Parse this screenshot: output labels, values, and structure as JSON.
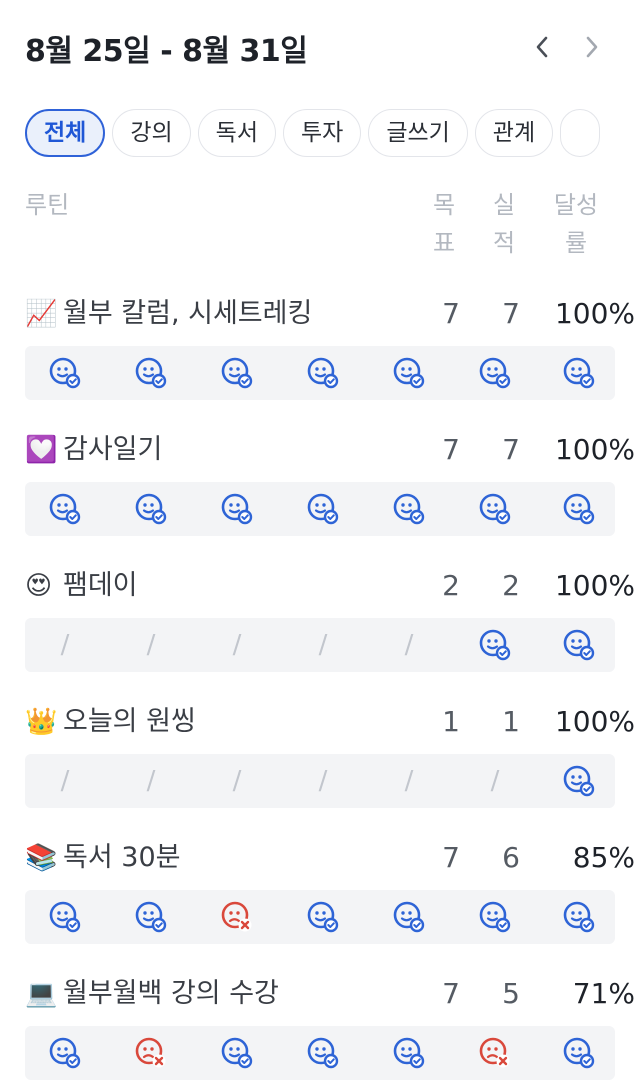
{
  "header": {
    "title": "8월 25일 - 8월 31일",
    "prev_icon": "chevron-left-icon",
    "next_icon": "chevron-right-icon"
  },
  "tabs": [
    {
      "label": "전체",
      "active": true
    },
    {
      "label": "강의",
      "active": false
    },
    {
      "label": "독서",
      "active": false
    },
    {
      "label": "투자",
      "active": false
    },
    {
      "label": "글쓰기",
      "active": false
    },
    {
      "label": "관계",
      "active": false
    },
    {
      "label": "",
      "active": false
    }
  ],
  "columns": {
    "routine": "루틴",
    "goal": "목\n표",
    "actual": "실\n적",
    "rate": "달성\n률"
  },
  "colors": {
    "accent": "#2f62d8",
    "success_icon": "#2e64d6",
    "fail_icon": "#d9483b",
    "day_bg": "#f3f4f6"
  },
  "routines": [
    {
      "emoji": "📈",
      "name": "월부 칼럼, 시세트레킹",
      "goal": "7",
      "actual": "7",
      "rate": "100%",
      "days": [
        "done",
        "done",
        "done",
        "done",
        "done",
        "done",
        "done"
      ]
    },
    {
      "emoji": "💟",
      "name": "감사일기",
      "goal": "7",
      "actual": "7",
      "rate": "100%",
      "days": [
        "done",
        "done",
        "done",
        "done",
        "done",
        "done",
        "done"
      ]
    },
    {
      "emoji": "😍",
      "name": "팸데이",
      "goal": "2",
      "actual": "2",
      "rate": "100%",
      "days": [
        "none",
        "none",
        "none",
        "none",
        "none",
        "done",
        "done"
      ]
    },
    {
      "emoji": "👑",
      "name": "오늘의 원씽",
      "goal": "1",
      "actual": "1",
      "rate": "100%",
      "days": [
        "none",
        "none",
        "none",
        "none",
        "none",
        "none",
        "done"
      ]
    },
    {
      "emoji": "📚",
      "name": "독서 30분",
      "goal": "7",
      "actual": "6",
      "rate": "85%",
      "days": [
        "done",
        "done",
        "fail",
        "done",
        "done",
        "done",
        "done"
      ]
    },
    {
      "emoji": "💻",
      "name": "월부월백 강의 수강",
      "goal": "7",
      "actual": "5",
      "rate": "71%",
      "days": [
        "done",
        "fail",
        "done",
        "done",
        "done",
        "fail",
        "done"
      ]
    }
  ],
  "day_icons": {
    "done": "smile-check-icon",
    "fail": "sad-x-icon",
    "none": "slash"
  }
}
